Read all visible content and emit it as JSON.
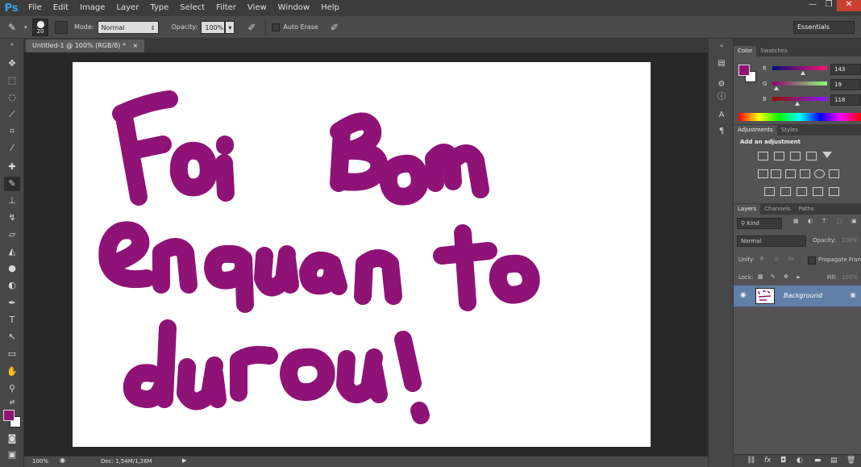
{
  "app": {
    "logo": "Ps"
  },
  "menu": [
    "File",
    "Edit",
    "Image",
    "Layer",
    "Type",
    "Select",
    "Filter",
    "View",
    "Window",
    "Help"
  ],
  "window_controls": {
    "minimize": "—",
    "restore": "❐",
    "close": "✕"
  },
  "options": {
    "brush_size": "20",
    "mode_label": "Mode:",
    "mode_value": "Normal",
    "opacity_label": "Opacity:",
    "opacity_value": "100%",
    "auto_erase_label": "Auto Erase",
    "workspace": "Essentials"
  },
  "document": {
    "tab_title": "Untitled-1 @ 100% (RGB/8) *",
    "tab_close": "×"
  },
  "canvas_text": [
    "Foi",
    "Bom",
    "enquanto",
    "durou!"
  ],
  "colors": {
    "foreground": "#8f1376",
    "background": "#ffffff",
    "ink": "#8f1376"
  },
  "status": {
    "zoom": "100%",
    "doc": "Doc: 1,54M/1,26M"
  },
  "color_panel": {
    "tabs": [
      "Color",
      "Swatches"
    ],
    "channels": [
      {
        "name": "R",
        "value": "143",
        "level": 143
      },
      {
        "name": "G",
        "value": "19",
        "level": 19
      },
      {
        "name": "B",
        "value": "118",
        "level": 118
      }
    ]
  },
  "adjustments_panel": {
    "tabs": [
      "Adjustments",
      "Styles"
    ],
    "heading": "Add an adjustment"
  },
  "layers_panel": {
    "tabs": [
      "Layers",
      "Channels",
      "Paths"
    ],
    "kind_label": "Kind",
    "blend_mode": "Normal",
    "opacity_label": "Opacity:",
    "opacity_value": "100%",
    "unify_label": "Unify:",
    "propagate_label": "Propagate Fran",
    "lock_label": "Lock:",
    "fill_label": "Fill:",
    "fill_value": "100%",
    "layer_name": "Background"
  }
}
